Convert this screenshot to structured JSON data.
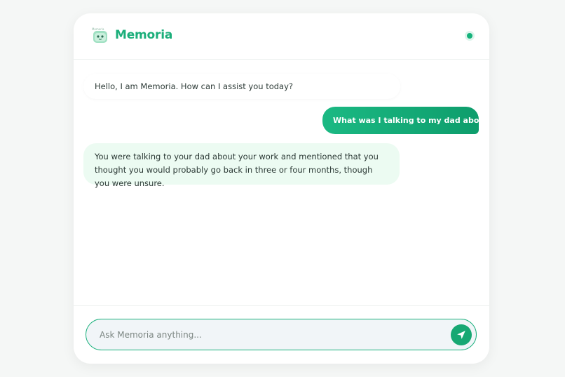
{
  "header": {
    "logo_caption": "Memoria",
    "brand": "Memoria",
    "status": "online",
    "status_color": "#15b27b"
  },
  "messages": [
    {
      "role": "assistant",
      "text": "Hello, I am Memoria. How can I assist you today?"
    },
    {
      "role": "user",
      "text": "What was I talking to my dad about ?"
    },
    {
      "role": "assistant",
      "text": "You were talking to your dad about your work and mentioned that you thought you would probably go back in three or four months, though you were unsure."
    }
  ],
  "composer": {
    "placeholder": "Ask Memoria anything...",
    "value": "",
    "send_icon": "send-icon"
  },
  "colors": {
    "accent": "#1bae7a",
    "user_bubble_start": "#1bb983",
    "user_bubble_end": "#0e9d6c",
    "assistant_bubble": "#ecfbf2",
    "input_bg": "#f1f5f8"
  }
}
